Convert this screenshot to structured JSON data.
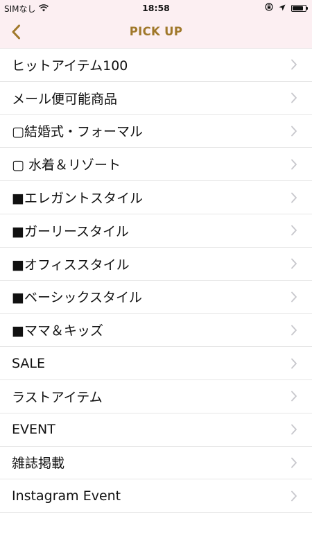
{
  "status_bar": {
    "carrier": "SIMなし",
    "time": "18:58",
    "battery_level": 0.85
  },
  "nav": {
    "title": "PICK UP",
    "back_icon": "chevron-left-icon"
  },
  "colors": {
    "accent": "#a0782a",
    "header_bg": "#fceff2",
    "separator": "#e6e6e6",
    "chevron": "#c7c7cc"
  },
  "items": [
    {
      "label": "ヒットアイテム100"
    },
    {
      "label": "メール便可能商品"
    },
    {
      "label": "▢結婚式・フォーマル"
    },
    {
      "label": "▢ 水着＆リゾート"
    },
    {
      "label": "■エレガントスタイル"
    },
    {
      "label": "■ガーリースタイル"
    },
    {
      "label": "■オフィススタイル"
    },
    {
      "label": "■ベーシックスタイル"
    },
    {
      "label": "■ママ＆キッズ"
    },
    {
      "label": "SALE"
    },
    {
      "label": "ラストアイテム"
    },
    {
      "label": "EVENT"
    },
    {
      "label": "雑誌掲載"
    },
    {
      "label": "Instagram Event"
    }
  ]
}
